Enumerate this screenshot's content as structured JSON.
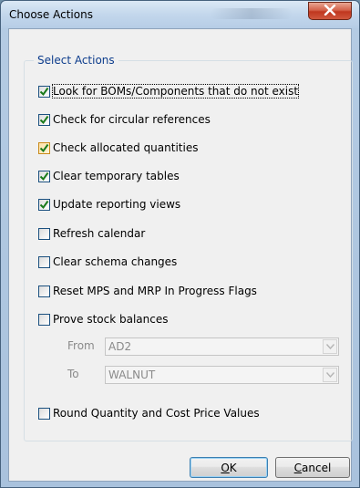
{
  "window": {
    "title": "Choose Actions"
  },
  "group": {
    "legend": "Select Actions"
  },
  "actions": [
    {
      "label": "Look for BOMs/Components that do not exist",
      "checked": true
    },
    {
      "label": "Check for circular references",
      "checked": true
    },
    {
      "label": "Check allocated quantities",
      "checked": true
    },
    {
      "label": "Clear temporary tables",
      "checked": true
    },
    {
      "label": "Update reporting views",
      "checked": true
    },
    {
      "label": "Refresh calendar",
      "checked": false
    },
    {
      "label": "Clear schema changes",
      "checked": false
    },
    {
      "label": "Reset MPS and MRP In Progress Flags",
      "checked": false
    },
    {
      "label": "Prove stock balances",
      "checked": false
    }
  ],
  "range": {
    "from_label": "From",
    "from_value": "AD2",
    "to_label": "To",
    "to_value": "WALNUT"
  },
  "round_option": {
    "label": "Round Quantity and Cost Price Values",
    "checked": false
  },
  "buttons": {
    "ok": {
      "accel": "O",
      "rest": "K"
    },
    "cancel": {
      "accel": "C",
      "rest": "ancel"
    }
  },
  "colors": {
    "legend": "#0c3c8c",
    "check": "#1a7a1a",
    "check_hover": "#e2a21a"
  }
}
